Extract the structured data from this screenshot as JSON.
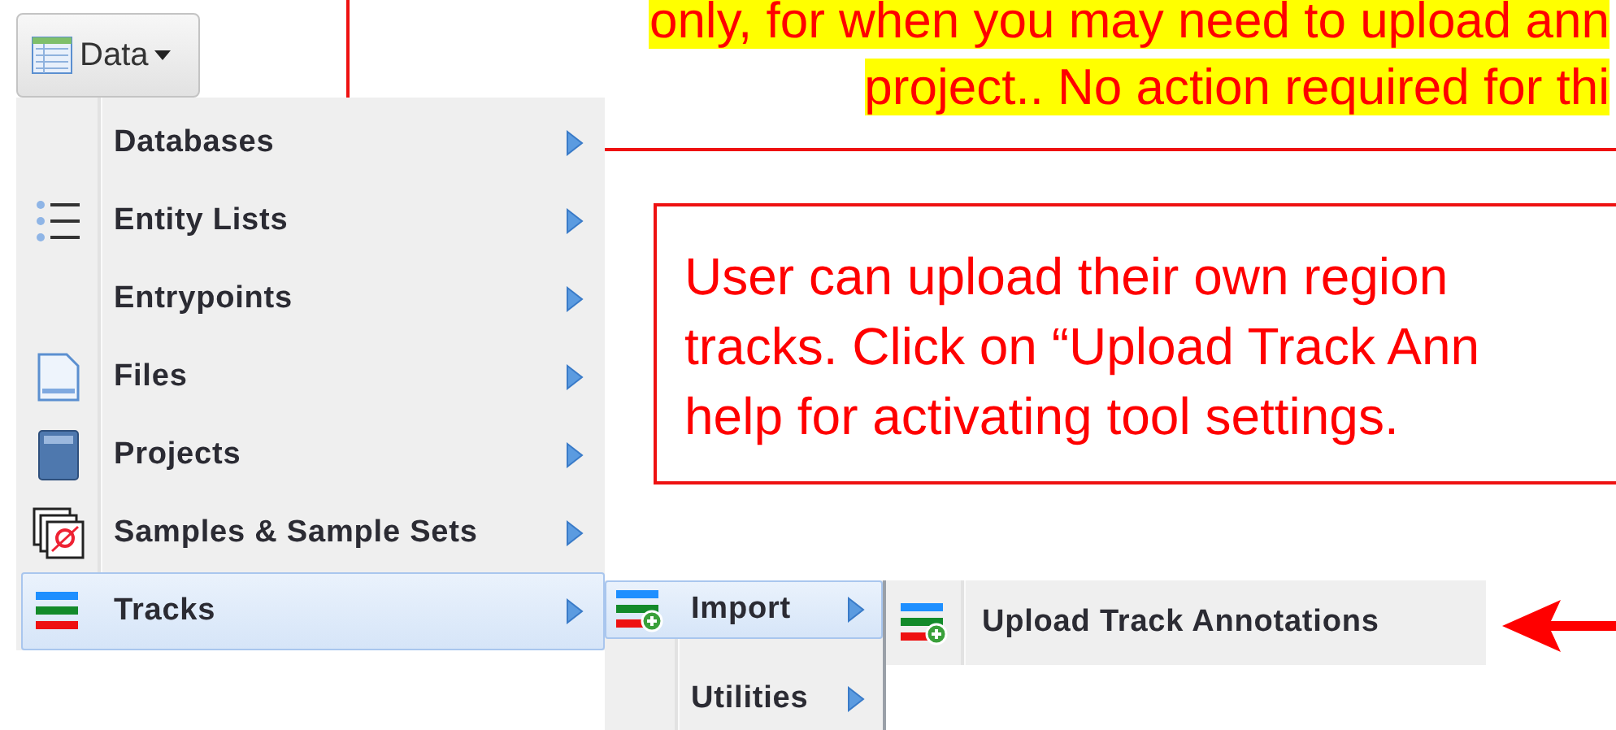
{
  "toolbar": {
    "data_button": {
      "label": "Data"
    }
  },
  "menu": {
    "items": [
      {
        "label": "Databases",
        "selected": false
      },
      {
        "label": "Entity Lists",
        "selected": false
      },
      {
        "label": "Entrypoints",
        "selected": false
      },
      {
        "label": "Files",
        "selected": false
      },
      {
        "label": "Projects",
        "selected": false
      },
      {
        "label": "Samples & Sample Sets",
        "selected": false
      },
      {
        "label": "Tracks",
        "selected": true
      }
    ]
  },
  "submenu": {
    "items": [
      {
        "label": "Import",
        "selected": true
      },
      {
        "label": "Utilities",
        "selected": false
      }
    ]
  },
  "import_menu": {
    "items": [
      {
        "label": "Upload Track Annotations",
        "selected": false
      }
    ]
  },
  "callouts": [
    {
      "highlight": true,
      "lines": [
        "only, for when you may need to upload ann",
        "project.. No action required for thi"
      ]
    },
    {
      "highlight": false,
      "lines": [
        "User can upload their own region",
        "tracks. Click on “Upload Track Ann",
        "help for activating tool settings."
      ]
    }
  ]
}
